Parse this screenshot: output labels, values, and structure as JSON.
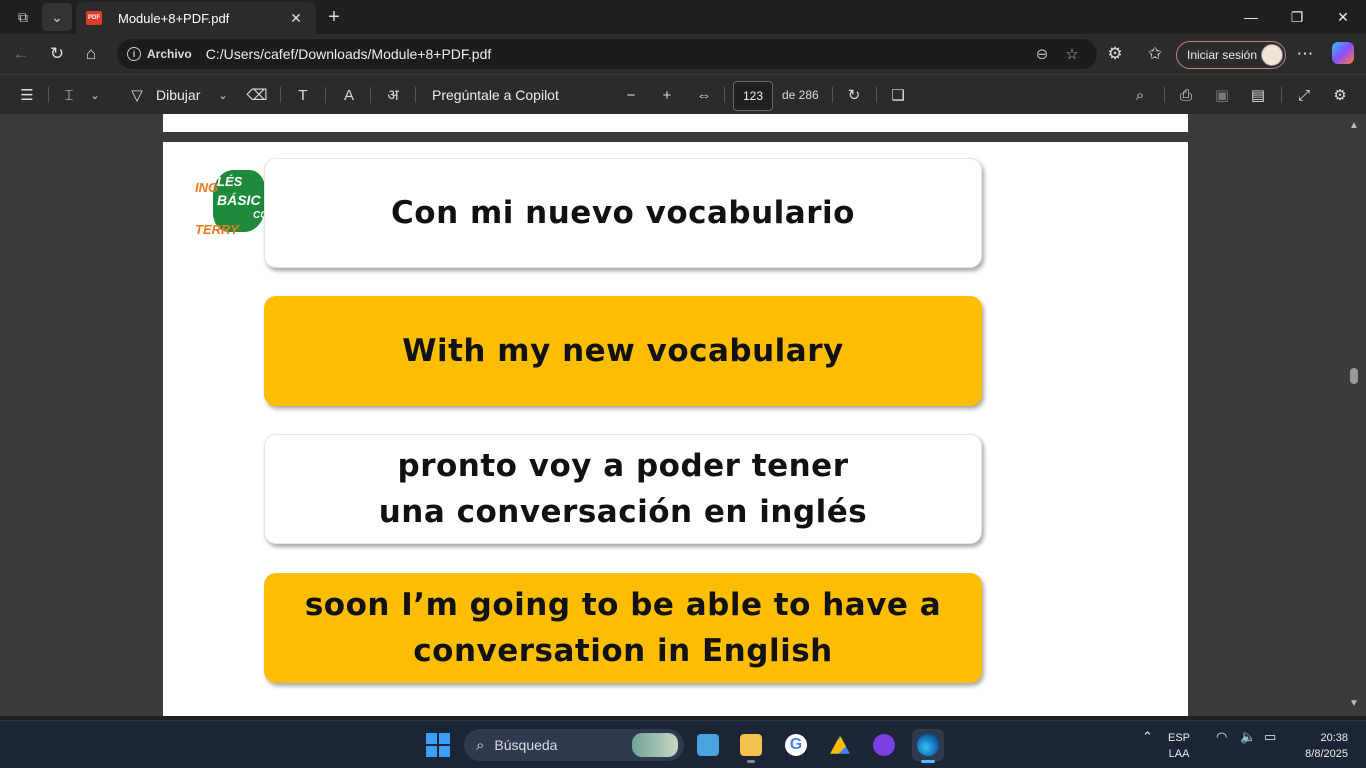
{
  "browser": {
    "tab_title": "Module+8+PDF.pdf",
    "address_scheme": "Archivo",
    "address_url": "C:/Users/cafef/Downloads/Module+8+PDF.pdf",
    "signin_label": "Iniciar sesión"
  },
  "pdf_toolbar": {
    "draw_label": "Dibujar",
    "copilot_label": "Pregúntale a Copilot",
    "current_page": "123",
    "total_pages_label": "de 286"
  },
  "document": {
    "logo": {
      "line1": "ING",
      "line2": "LÉS",
      "line3": "BÁSIC",
      "line4": "CO",
      "line5": "TERRY"
    },
    "cards": [
      {
        "style": "white",
        "lines": [
          "Con mi nuevo vocabulario"
        ]
      },
      {
        "style": "yellow",
        "lines": [
          "With my new vocabulary"
        ]
      },
      {
        "style": "white",
        "lines": [
          "pronto voy a poder tener",
          "una conversación en inglés"
        ]
      },
      {
        "style": "yellow",
        "lines": [
          "soon I’m going to be able to have a",
          "conversation in English"
        ]
      }
    ]
  },
  "taskbar": {
    "search_placeholder": "Búsqueda",
    "lang_line1": "ESP",
    "lang_line2": "LAA",
    "time": "20:38",
    "date": "8/8/2025"
  },
  "colors": {
    "accent_yellow": "#fdbd00",
    "logo_green": "#1e8a3c",
    "logo_orange": "#f07a20"
  }
}
